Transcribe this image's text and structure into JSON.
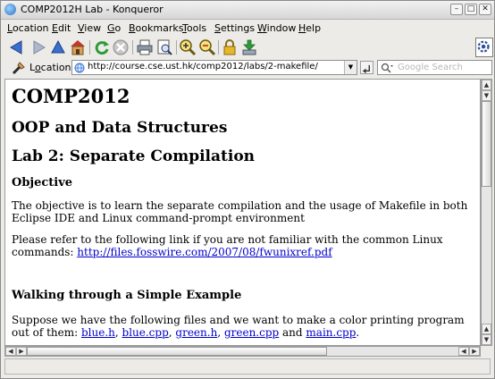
{
  "window": {
    "title": "COMP2012H Lab - Konqueror"
  },
  "menu": {
    "items": [
      {
        "label": "Location",
        "mnemonic": "L",
        "rest": "ocation"
      },
      {
        "label": "Edit",
        "mnemonic": "E",
        "rest": "dit"
      },
      {
        "label": "View",
        "mnemonic": "V",
        "rest": "iew"
      },
      {
        "label": "Go",
        "mnemonic": "G",
        "rest": "o"
      },
      {
        "label": "Bookmarks",
        "mnemonic": "B",
        "rest": "ookmarks"
      },
      {
        "label": "Tools",
        "mnemonic": "T",
        "rest": "ools"
      },
      {
        "label": "Settings",
        "mnemonic": "S",
        "rest": "ettings"
      },
      {
        "label": "Window",
        "mnemonic": "W",
        "rest": "indow"
      },
      {
        "label": "Help",
        "mnemonic": "H",
        "rest": "elp"
      }
    ]
  },
  "toolbar": {
    "icons": [
      "back-icon",
      "forward-icon",
      "up-icon",
      "home-icon",
      "reload-icon",
      "stop-icon",
      "print-icon",
      "print-preview-icon",
      "zoom-in-icon",
      "zoom-out-icon",
      "lock-icon",
      "download-icon"
    ]
  },
  "location": {
    "label_pre": "L",
    "label_mnemonic": "o",
    "label_post": "cation:",
    "url": "http://course.cse.ust.hk/comp2012/labs/2-makefile/",
    "search_placeholder": "Google Search"
  },
  "page": {
    "h1": "COMP2012",
    "h2_course": "OOP and Data Structures",
    "h2_lab": "Lab 2: Separate Compilation",
    "objective_heading": "Objective",
    "objective_text": "The objective is to learn the separate compilation and the usage of Makefile in both Eclipse IDE and Linux command-prompt environment",
    "refer_text": "Please refer to the following link if you are not familiar with the common Linux commands: ",
    "refer_link": "http://files.fosswire.com/2007/08/fwunixref.pdf",
    "example_heading": "Walking through a Simple Example",
    "example_text_pre": "Suppose we have the following files and we want to make a color printing program out of them: ",
    "files": [
      "blue.h",
      "blue.cpp",
      "green.h",
      "green.cpp",
      "main.cpp"
    ],
    "sep_comma": ", ",
    "sep_and": " and ",
    "sep_period": "."
  },
  "status": {
    "text": ""
  },
  "colors": {
    "link": "#0000cc",
    "chrome": "#ecebe7"
  }
}
